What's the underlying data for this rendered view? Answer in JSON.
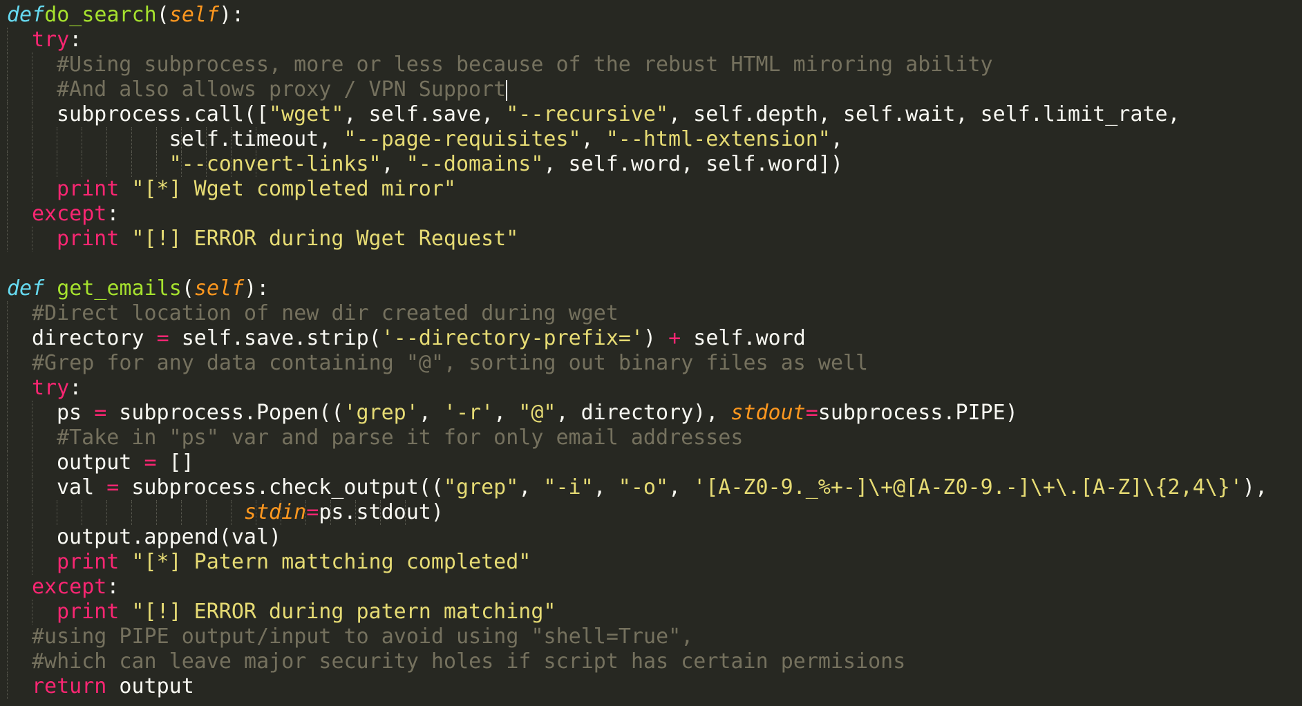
{
  "editor": {
    "theme_colors": {
      "background": "#272822",
      "keyword": "#f92672",
      "def": "#66d9ef",
      "function": "#a6e22e",
      "self": "#fd971f",
      "string": "#e6db74",
      "comment": "#75715e",
      "text": "#f8f8f2"
    },
    "lines": [
      {
        "indent": 0,
        "tokens": [
          [
            "def",
            "def"
          ],
          [
            " ",
            ""
          ],
          [
            "fname",
            "do_search"
          ],
          [
            "plain",
            "("
          ],
          [
            "self",
            "self"
          ],
          [
            "plain",
            "):"
          ]
        ]
      },
      {
        "indent": 1,
        "tokens": [
          [
            "kw",
            "try"
          ],
          [
            "plain",
            ":"
          ]
        ]
      },
      {
        "indent": 2,
        "tokens": [
          [
            "comment",
            "#Using subprocess, more or less because of the rebust HTML miroring ability"
          ]
        ]
      },
      {
        "indent": 2,
        "cursor_after": true,
        "tokens": [
          [
            "comment",
            "#And also allows proxy / VPN Support"
          ]
        ]
      },
      {
        "indent": 2,
        "tokens": [
          [
            "plain",
            "subprocess.call(["
          ],
          [
            "str",
            "\"wget\""
          ],
          [
            "plain",
            ", self.save, "
          ],
          [
            "str",
            "\"--recursive\""
          ],
          [
            "plain",
            ", self.depth, self.wait, self.limit_rate,"
          ]
        ]
      },
      {
        "indent": 2,
        "extra_guides": 9,
        "tokens": [
          [
            "plain",
            "         self.timeout, "
          ],
          [
            "str",
            "\"--page-requisites\""
          ],
          [
            "plain",
            ", "
          ],
          [
            "str",
            "\"--html-extension\""
          ],
          [
            "plain",
            ","
          ]
        ]
      },
      {
        "indent": 2,
        "extra_guides": 9,
        "tokens": [
          [
            "plain",
            "         "
          ],
          [
            "str",
            "\"--convert-links\""
          ],
          [
            "plain",
            ", "
          ],
          [
            "str",
            "\"--domains\""
          ],
          [
            "plain",
            ", self.word, self.word])"
          ]
        ]
      },
      {
        "indent": 2,
        "tokens": [
          [
            "kw",
            "print"
          ],
          [
            "plain",
            " "
          ],
          [
            "str",
            "\"[*] Wget completed miror\""
          ]
        ]
      },
      {
        "indent": 1,
        "tokens": [
          [
            "kw",
            "except"
          ],
          [
            "plain",
            ":"
          ]
        ]
      },
      {
        "indent": 2,
        "tokens": [
          [
            "kw",
            "print"
          ],
          [
            "plain",
            " "
          ],
          [
            "str",
            "\"[!] ERROR during Wget Request\""
          ]
        ]
      },
      {
        "indent": 0,
        "tokens": []
      },
      {
        "indent": 0,
        "tokens": [
          [
            "def",
            "def"
          ],
          [
            "",
            ""
          ],
          [
            "plain",
            " "
          ],
          [
            "fname",
            "get_emails"
          ],
          [
            "plain",
            "("
          ],
          [
            "self",
            "self"
          ],
          [
            "plain",
            "):"
          ]
        ]
      },
      {
        "indent": 1,
        "tokens": [
          [
            "comment",
            "#Direct location of new dir created during wget"
          ]
        ]
      },
      {
        "indent": 1,
        "tokens": [
          [
            "plain",
            "directory "
          ],
          [
            "op",
            "="
          ],
          [
            "plain",
            " self.save.strip("
          ],
          [
            "str",
            "'--directory-prefix='"
          ],
          [
            "plain",
            ") "
          ],
          [
            "op",
            "+"
          ],
          [
            "plain",
            " self.word"
          ]
        ]
      },
      {
        "indent": 1,
        "tokens": [
          [
            "comment",
            "#Grep for any data containing \"@\", sorting out binary files as well"
          ]
        ]
      },
      {
        "indent": 1,
        "tokens": [
          [
            "kw",
            "try"
          ],
          [
            "plain",
            ":"
          ]
        ]
      },
      {
        "indent": 2,
        "tokens": [
          [
            "plain",
            "ps "
          ],
          [
            "op",
            "="
          ],
          [
            "plain",
            " subprocess.Popen(("
          ],
          [
            "str",
            "'grep'"
          ],
          [
            "plain",
            ", "
          ],
          [
            "str",
            "'-r'"
          ],
          [
            "plain",
            ", "
          ],
          [
            "str",
            "\"@\""
          ],
          [
            "plain",
            ", directory), "
          ],
          [
            "kwarg",
            "stdout"
          ],
          [
            "op",
            "="
          ],
          [
            "plain",
            "subprocess.PIPE)"
          ]
        ]
      },
      {
        "indent": 2,
        "tokens": [
          [
            "comment",
            "#Take in \"ps\" var and parse it for only email addresses"
          ]
        ]
      },
      {
        "indent": 2,
        "tokens": [
          [
            "plain",
            "output "
          ],
          [
            "op",
            "="
          ],
          [
            "plain",
            " []"
          ]
        ]
      },
      {
        "indent": 2,
        "tokens": [
          [
            "plain",
            "val "
          ],
          [
            "op",
            "="
          ],
          [
            "plain",
            " subprocess.check_output(("
          ],
          [
            "str",
            "\"grep\""
          ],
          [
            "plain",
            ", "
          ],
          [
            "str",
            "\"-i\""
          ],
          [
            "plain",
            ", "
          ],
          [
            "str",
            "\"-o\""
          ],
          [
            "plain",
            ", "
          ],
          [
            "str",
            "'[A-Z0-9._%+-]\\+@[A-Z0-9.-]\\+\\.[A-Z]\\{2,4\\}'"
          ],
          [
            "plain",
            "),"
          ]
        ]
      },
      {
        "indent": 2,
        "extra_guides": 15,
        "tokens": [
          [
            "plain",
            "               "
          ],
          [
            "kwarg",
            "stdin"
          ],
          [
            "op",
            "="
          ],
          [
            "plain",
            "ps.stdout)"
          ]
        ]
      },
      {
        "indent": 2,
        "tokens": [
          [
            "plain",
            "output.append(val)"
          ]
        ]
      },
      {
        "indent": 2,
        "tokens": [
          [
            "kw",
            "print"
          ],
          [
            "plain",
            " "
          ],
          [
            "str",
            "\"[*] Patern mattching completed\""
          ]
        ]
      },
      {
        "indent": 1,
        "tokens": [
          [
            "kw",
            "except"
          ],
          [
            "plain",
            ":"
          ]
        ]
      },
      {
        "indent": 2,
        "tokens": [
          [
            "kw",
            "print"
          ],
          [
            "plain",
            " "
          ],
          [
            "str",
            "\"[!] ERROR during patern matching\""
          ]
        ]
      },
      {
        "indent": 1,
        "tokens": [
          [
            "comment",
            "#using PIPE output/input to avoid using \"shell=True\","
          ]
        ]
      },
      {
        "indent": 1,
        "tokens": [
          [
            "comment",
            "#which can leave major security holes if script has certain permisions"
          ]
        ]
      },
      {
        "indent": 1,
        "tokens": [
          [
            "kw",
            "return"
          ],
          [
            "plain",
            " output"
          ]
        ]
      }
    ]
  }
}
